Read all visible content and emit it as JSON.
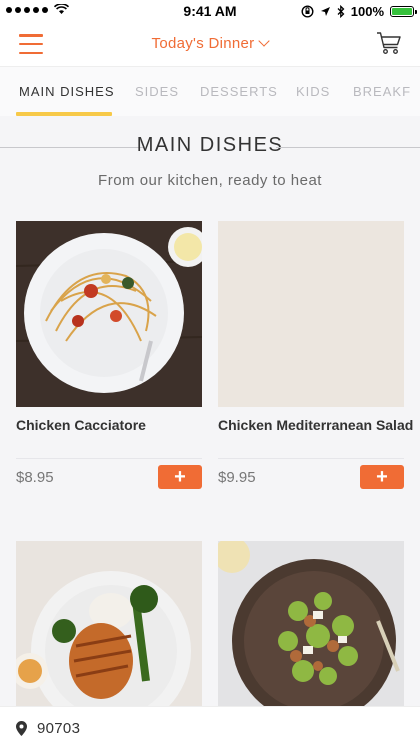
{
  "status_bar": {
    "time": "9:41 AM",
    "battery": "100%"
  },
  "nav": {
    "title": "Today's Dinner"
  },
  "tabs": [
    {
      "label": "MAIN DISHES"
    },
    {
      "label": "SIDES"
    },
    {
      "label": "DESSERTS"
    },
    {
      "label": "KIDS"
    },
    {
      "label": "BREAKF"
    }
  ],
  "section": {
    "title": "MAIN DISHES",
    "subtitle": "From our kitchen, ready to heat"
  },
  "products": [
    {
      "name": "Chicken Cacciatore",
      "price": "$8.95",
      "add_label": "+"
    },
    {
      "name": "Chicken Mediterranean Salad",
      "price": "$9.95",
      "add_label": "+"
    },
    {
      "name": "",
      "price": "",
      "add_label": ""
    },
    {
      "name": "",
      "price": "",
      "add_label": ""
    }
  ],
  "location": {
    "zip": "90703"
  },
  "colors": {
    "accent": "#f06c35",
    "tab_underline": "#f7c948",
    "battery": "#36c13c"
  }
}
